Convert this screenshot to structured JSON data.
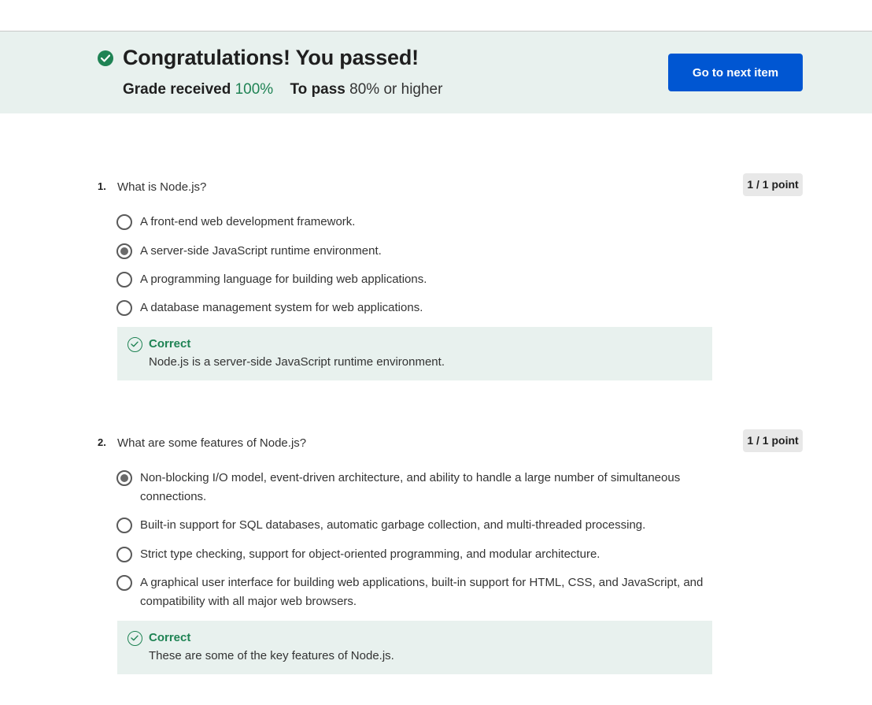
{
  "banner": {
    "title": "Congratulations! You passed!",
    "grade_label": "Grade received",
    "grade_value": "100%",
    "pass_label": "To pass",
    "pass_value": "80% or higher",
    "next_button": "Go to next item"
  },
  "questions": [
    {
      "number": "1.",
      "text": "What is Node.js?",
      "points": "1 / 1 point",
      "options": [
        {
          "label": "A front-end web development framework.",
          "selected": false
        },
        {
          "label": "A server-side JavaScript runtime environment.",
          "selected": true
        },
        {
          "label": "A programming language for building web applications.",
          "selected": false
        },
        {
          "label": "A database management system for web applications.",
          "selected": false
        }
      ],
      "feedback": {
        "status": "Correct",
        "text": "Node.js is a server-side JavaScript runtime environment."
      }
    },
    {
      "number": "2.",
      "text": "What are some features of Node.js?",
      "points": "1 / 1 point",
      "options": [
        {
          "label": "Non-blocking I/O model, event-driven architecture, and ability to handle a large number of simultaneous connections.",
          "selected": true
        },
        {
          "label": "Built-in support for SQL databases, automatic garbage collection, and multi-threaded processing.",
          "selected": false
        },
        {
          "label": "Strict type checking, support for object-oriented programming, and modular architecture.",
          "selected": false
        },
        {
          "label": "A graphical user interface for building web applications, built-in support for HTML, CSS, and JavaScript, and compatibility with all major web browsers.",
          "selected": false
        }
      ],
      "feedback": {
        "status": "Correct",
        "text": "These are some of the key features of Node.js."
      }
    }
  ],
  "colors": {
    "success": "#1f8354",
    "primary_button": "#0056d2",
    "banner_bg": "#e8f1ee"
  },
  "icons": {
    "banner": "check-circle-filled-icon",
    "feedback": "check-circle-outline-icon"
  }
}
